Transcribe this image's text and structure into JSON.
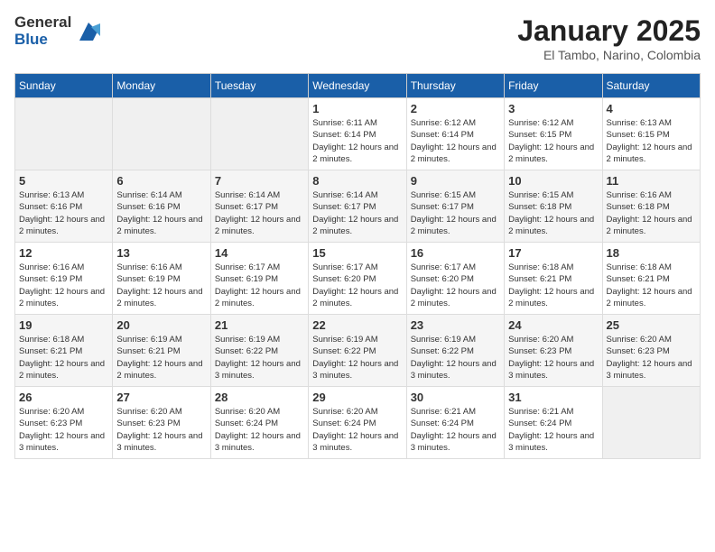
{
  "header": {
    "logo_line1": "General",
    "logo_line2": "Blue",
    "month": "January 2025",
    "location": "El Tambo, Narino, Colombia"
  },
  "days_of_week": [
    "Sunday",
    "Monday",
    "Tuesday",
    "Wednesday",
    "Thursday",
    "Friday",
    "Saturday"
  ],
  "weeks": [
    [
      {
        "day": "",
        "sunrise": "",
        "sunset": "",
        "daylight": ""
      },
      {
        "day": "",
        "sunrise": "",
        "sunset": "",
        "daylight": ""
      },
      {
        "day": "",
        "sunrise": "",
        "sunset": "",
        "daylight": ""
      },
      {
        "day": "1",
        "sunrise": "Sunrise: 6:11 AM",
        "sunset": "Sunset: 6:14 PM",
        "daylight": "Daylight: 12 hours and 2 minutes."
      },
      {
        "day": "2",
        "sunrise": "Sunrise: 6:12 AM",
        "sunset": "Sunset: 6:14 PM",
        "daylight": "Daylight: 12 hours and 2 minutes."
      },
      {
        "day": "3",
        "sunrise": "Sunrise: 6:12 AM",
        "sunset": "Sunset: 6:15 PM",
        "daylight": "Daylight: 12 hours and 2 minutes."
      },
      {
        "day": "4",
        "sunrise": "Sunrise: 6:13 AM",
        "sunset": "Sunset: 6:15 PM",
        "daylight": "Daylight: 12 hours and 2 minutes."
      }
    ],
    [
      {
        "day": "5",
        "sunrise": "Sunrise: 6:13 AM",
        "sunset": "Sunset: 6:16 PM",
        "daylight": "Daylight: 12 hours and 2 minutes."
      },
      {
        "day": "6",
        "sunrise": "Sunrise: 6:14 AM",
        "sunset": "Sunset: 6:16 PM",
        "daylight": "Daylight: 12 hours and 2 minutes."
      },
      {
        "day": "7",
        "sunrise": "Sunrise: 6:14 AM",
        "sunset": "Sunset: 6:17 PM",
        "daylight": "Daylight: 12 hours and 2 minutes."
      },
      {
        "day": "8",
        "sunrise": "Sunrise: 6:14 AM",
        "sunset": "Sunset: 6:17 PM",
        "daylight": "Daylight: 12 hours and 2 minutes."
      },
      {
        "day": "9",
        "sunrise": "Sunrise: 6:15 AM",
        "sunset": "Sunset: 6:17 PM",
        "daylight": "Daylight: 12 hours and 2 minutes."
      },
      {
        "day": "10",
        "sunrise": "Sunrise: 6:15 AM",
        "sunset": "Sunset: 6:18 PM",
        "daylight": "Daylight: 12 hours and 2 minutes."
      },
      {
        "day": "11",
        "sunrise": "Sunrise: 6:16 AM",
        "sunset": "Sunset: 6:18 PM",
        "daylight": "Daylight: 12 hours and 2 minutes."
      }
    ],
    [
      {
        "day": "12",
        "sunrise": "Sunrise: 6:16 AM",
        "sunset": "Sunset: 6:19 PM",
        "daylight": "Daylight: 12 hours and 2 minutes."
      },
      {
        "day": "13",
        "sunrise": "Sunrise: 6:16 AM",
        "sunset": "Sunset: 6:19 PM",
        "daylight": "Daylight: 12 hours and 2 minutes."
      },
      {
        "day": "14",
        "sunrise": "Sunrise: 6:17 AM",
        "sunset": "Sunset: 6:19 PM",
        "daylight": "Daylight: 12 hours and 2 minutes."
      },
      {
        "day": "15",
        "sunrise": "Sunrise: 6:17 AM",
        "sunset": "Sunset: 6:20 PM",
        "daylight": "Daylight: 12 hours and 2 minutes."
      },
      {
        "day": "16",
        "sunrise": "Sunrise: 6:17 AM",
        "sunset": "Sunset: 6:20 PM",
        "daylight": "Daylight: 12 hours and 2 minutes."
      },
      {
        "day": "17",
        "sunrise": "Sunrise: 6:18 AM",
        "sunset": "Sunset: 6:21 PM",
        "daylight": "Daylight: 12 hours and 2 minutes."
      },
      {
        "day": "18",
        "sunrise": "Sunrise: 6:18 AM",
        "sunset": "Sunset: 6:21 PM",
        "daylight": "Daylight: 12 hours and 2 minutes."
      }
    ],
    [
      {
        "day": "19",
        "sunrise": "Sunrise: 6:18 AM",
        "sunset": "Sunset: 6:21 PM",
        "daylight": "Daylight: 12 hours and 2 minutes."
      },
      {
        "day": "20",
        "sunrise": "Sunrise: 6:19 AM",
        "sunset": "Sunset: 6:21 PM",
        "daylight": "Daylight: 12 hours and 2 minutes."
      },
      {
        "day": "21",
        "sunrise": "Sunrise: 6:19 AM",
        "sunset": "Sunset: 6:22 PM",
        "daylight": "Daylight: 12 hours and 3 minutes."
      },
      {
        "day": "22",
        "sunrise": "Sunrise: 6:19 AM",
        "sunset": "Sunset: 6:22 PM",
        "daylight": "Daylight: 12 hours and 3 minutes."
      },
      {
        "day": "23",
        "sunrise": "Sunrise: 6:19 AM",
        "sunset": "Sunset: 6:22 PM",
        "daylight": "Daylight: 12 hours and 3 minutes."
      },
      {
        "day": "24",
        "sunrise": "Sunrise: 6:20 AM",
        "sunset": "Sunset: 6:23 PM",
        "daylight": "Daylight: 12 hours and 3 minutes."
      },
      {
        "day": "25",
        "sunrise": "Sunrise: 6:20 AM",
        "sunset": "Sunset: 6:23 PM",
        "daylight": "Daylight: 12 hours and 3 minutes."
      }
    ],
    [
      {
        "day": "26",
        "sunrise": "Sunrise: 6:20 AM",
        "sunset": "Sunset: 6:23 PM",
        "daylight": "Daylight: 12 hours and 3 minutes."
      },
      {
        "day": "27",
        "sunrise": "Sunrise: 6:20 AM",
        "sunset": "Sunset: 6:23 PM",
        "daylight": "Daylight: 12 hours and 3 minutes."
      },
      {
        "day": "28",
        "sunrise": "Sunrise: 6:20 AM",
        "sunset": "Sunset: 6:24 PM",
        "daylight": "Daylight: 12 hours and 3 minutes."
      },
      {
        "day": "29",
        "sunrise": "Sunrise: 6:20 AM",
        "sunset": "Sunset: 6:24 PM",
        "daylight": "Daylight: 12 hours and 3 minutes."
      },
      {
        "day": "30",
        "sunrise": "Sunrise: 6:21 AM",
        "sunset": "Sunset: 6:24 PM",
        "daylight": "Daylight: 12 hours and 3 minutes."
      },
      {
        "day": "31",
        "sunrise": "Sunrise: 6:21 AM",
        "sunset": "Sunset: 6:24 PM",
        "daylight": "Daylight: 12 hours and 3 minutes."
      },
      {
        "day": "",
        "sunrise": "",
        "sunset": "",
        "daylight": ""
      }
    ]
  ]
}
